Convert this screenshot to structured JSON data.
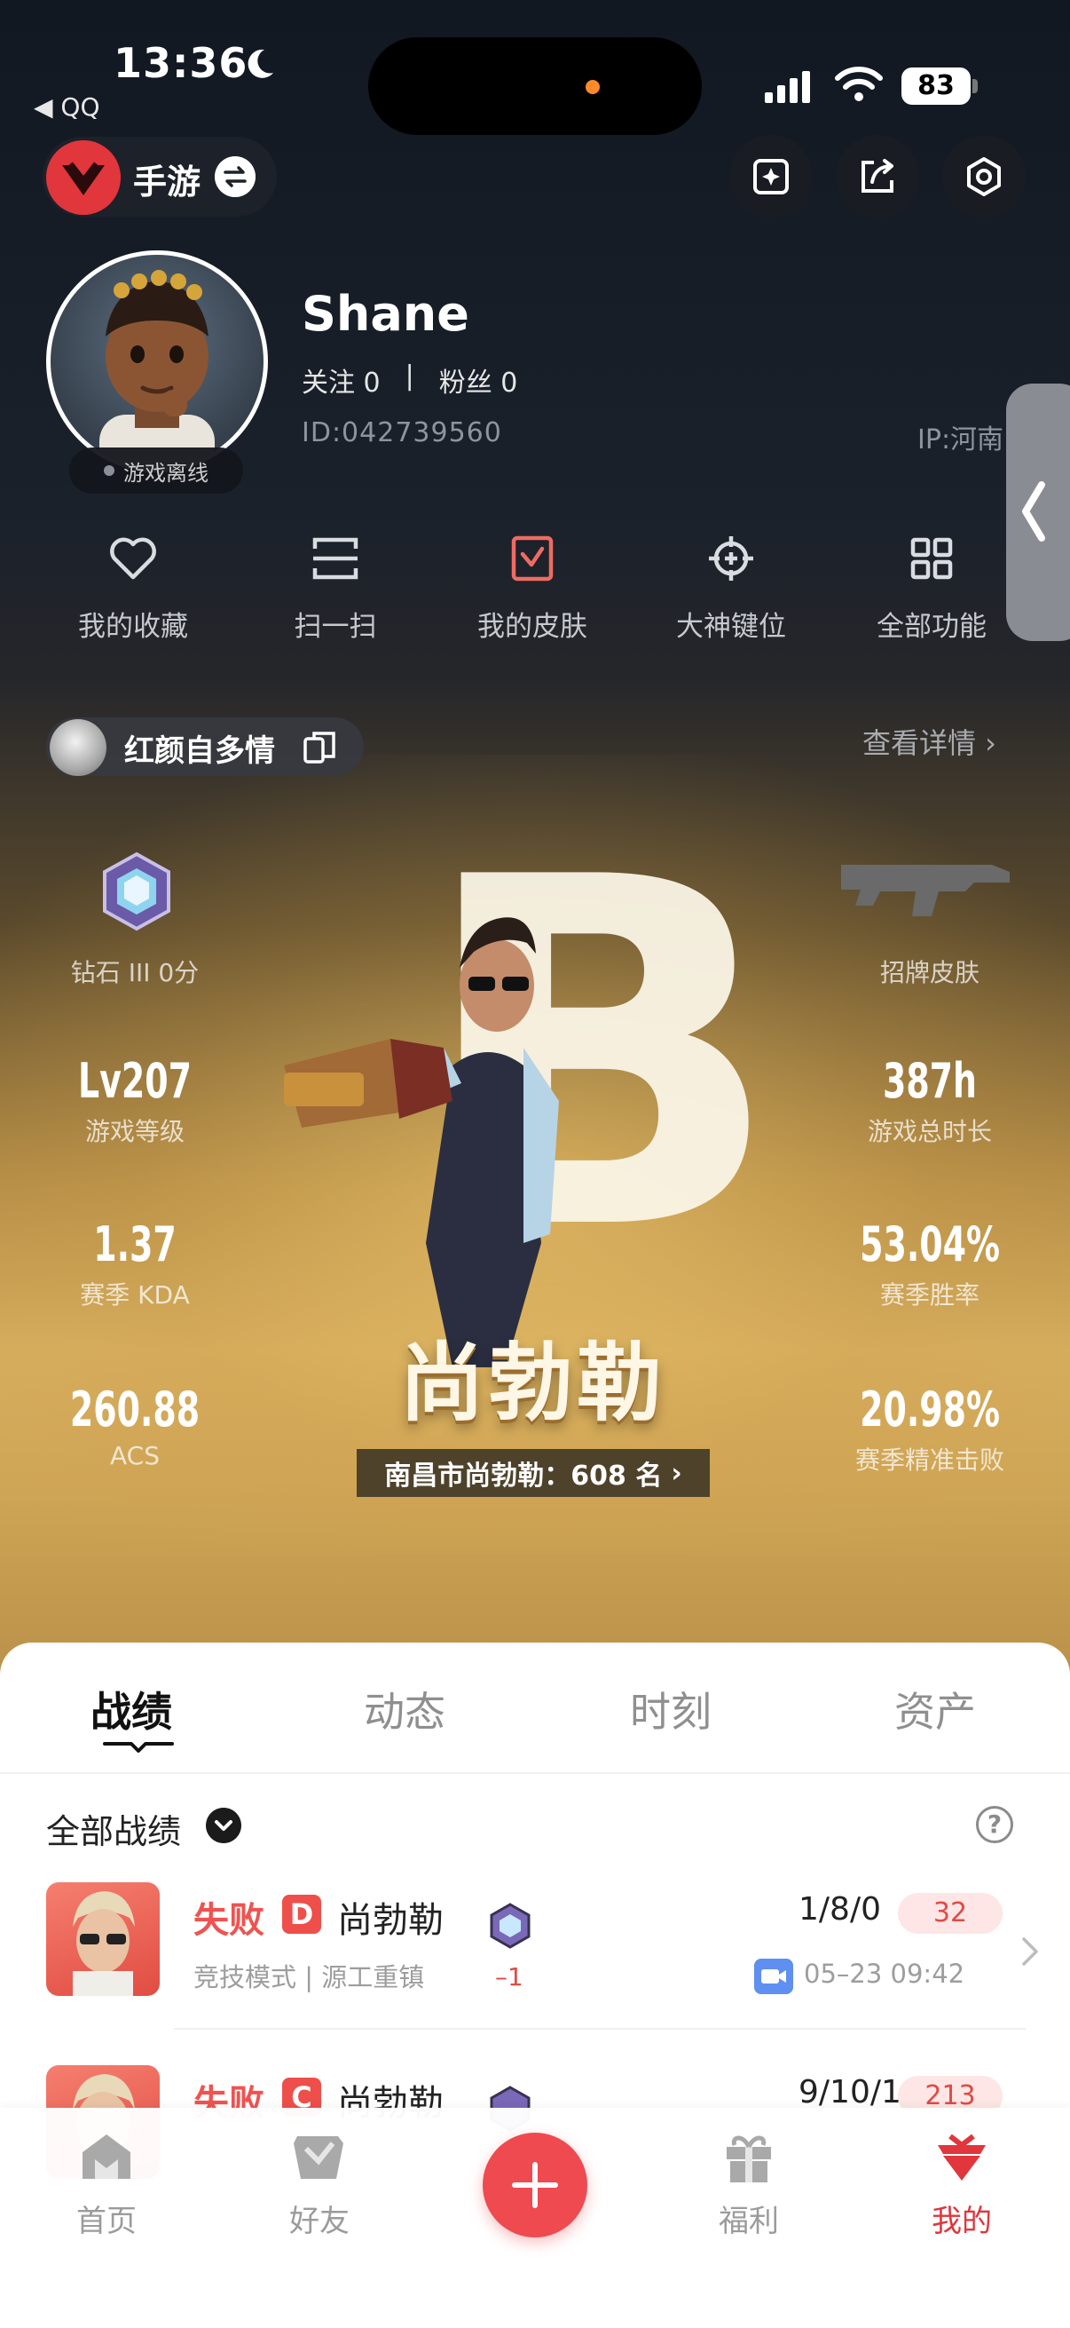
{
  "status_bar": {
    "time": "13:36",
    "back_app": "◀ QQ",
    "battery": "83"
  },
  "top_bar": {
    "game_label": "手游"
  },
  "profile": {
    "username": "Shane",
    "follow_label": "关注 0",
    "separator": "|",
    "fans_label": "粉丝 0",
    "id": "ID:042739560",
    "ip": "IP:河南",
    "status": "游戏离线"
  },
  "quick_actions": [
    {
      "label": "我的收藏",
      "icon": "heart-icon"
    },
    {
      "label": "扫一扫",
      "icon": "scan-icon"
    },
    {
      "label": "我的皮肤",
      "icon": "skin-icon"
    },
    {
      "label": "大神键位",
      "icon": "crosshair-icon"
    },
    {
      "label": "全部功能",
      "icon": "grid-icon"
    }
  ],
  "card": {
    "name": "红颜自多情",
    "detail_link": "查看详情 ›",
    "hero_name": "尚勃勒",
    "hero_rank": "南昌市尚勃勒：608 名",
    "big_letter": "B",
    "stats": {
      "rank": {
        "value": "",
        "label": "钻石 III 0分"
      },
      "skin": {
        "label": "招牌皮肤"
      },
      "level": {
        "value": "Lv207",
        "label": "游戏等级"
      },
      "hours": {
        "value": "387h",
        "label": "游戏总时长"
      },
      "kda": {
        "value": "1.37",
        "label": "赛季 KDA"
      },
      "winrate": {
        "value": "53.04%",
        "label": "赛季胜率"
      },
      "acs": {
        "value": "260.88",
        "label": "ACS"
      },
      "headshot": {
        "value": "20.98%",
        "label": "赛季精准击败"
      }
    }
  },
  "tabs": [
    {
      "label": "战绩",
      "active": true
    },
    {
      "label": "动态",
      "active": false
    },
    {
      "label": "时刻",
      "active": false
    },
    {
      "label": "资产",
      "active": false
    }
  ],
  "filter": {
    "label": "全部战绩",
    "help": "?"
  },
  "matches": [
    {
      "result": "失败",
      "grade": "D",
      "agent": "尚勃勒",
      "mode": "竞技模式 | 源工重镇",
      "rank_delta": "–1",
      "kda": "1/8/0",
      "score": "32",
      "time": "05–23 09:42"
    },
    {
      "result": "失败",
      "grade": "C",
      "agent": "尚勃勒",
      "mode": "",
      "rank_delta": "",
      "kda": "9/10/1",
      "score": "213",
      "time": ""
    }
  ],
  "nav": [
    {
      "label": "首页",
      "active": false
    },
    {
      "label": "好友",
      "active": false
    },
    {
      "label": "福利",
      "active": false
    },
    {
      "label": "我的",
      "active": true
    }
  ],
  "colors": {
    "accent": "#e0363c",
    "fail": "#ef5350",
    "gold": "#d6ad5e"
  }
}
